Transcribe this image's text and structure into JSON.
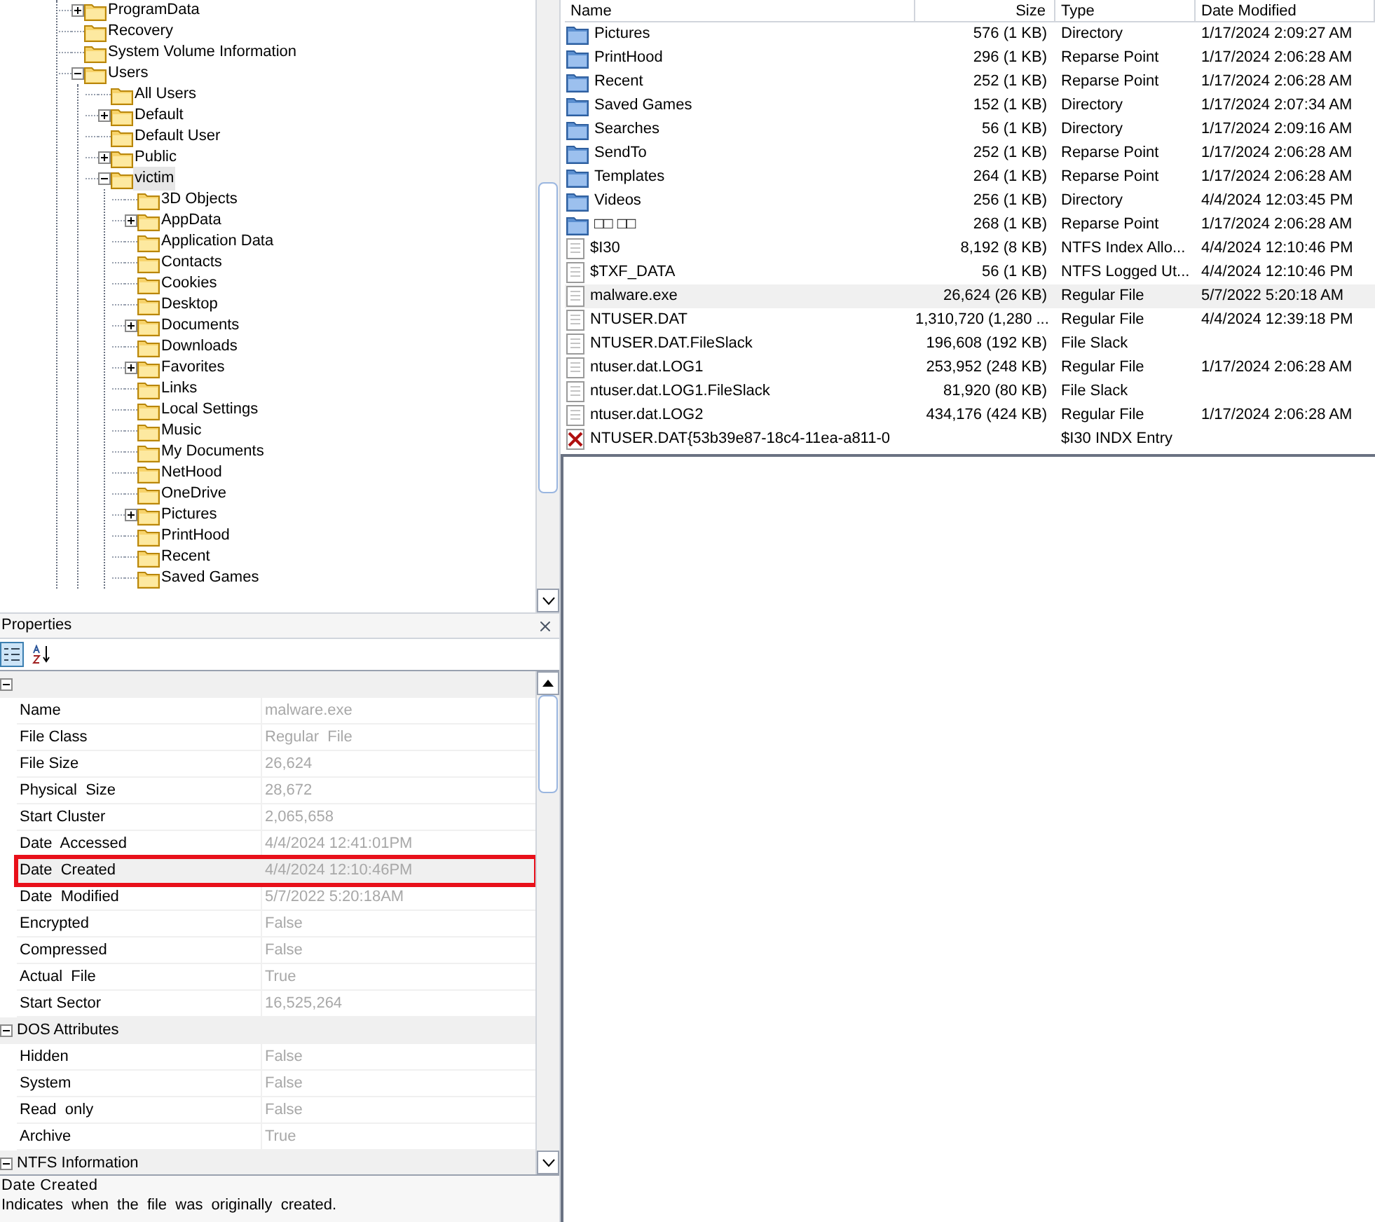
{
  "tree": [
    {
      "label": "ProgramData",
      "expanded": false,
      "selected": false
    },
    {
      "label": "Recovery",
      "selected": false
    },
    {
      "label": "System Volume Information",
      "selected": false
    },
    {
      "label": "Users",
      "expanded": true,
      "selected": false,
      "children": [
        {
          "label": "All Users",
          "selected": false
        },
        {
          "label": "Default",
          "expanded": false,
          "selected": false
        },
        {
          "label": "Default User",
          "selected": false
        },
        {
          "label": "Public",
          "expanded": false,
          "selected": false
        },
        {
          "label": "victim",
          "expanded": true,
          "selected": true,
          "children": [
            {
              "label": "3D Objects",
              "selected": false
            },
            {
              "label": "AppData",
              "expanded": false,
              "selected": false
            },
            {
              "label": "Application Data",
              "selected": false
            },
            {
              "label": "Contacts",
              "selected": false
            },
            {
              "label": "Cookies",
              "selected": false
            },
            {
              "label": "Desktop",
              "selected": false
            },
            {
              "label": "Documents",
              "expanded": false,
              "selected": false
            },
            {
              "label": "Downloads",
              "selected": false
            },
            {
              "label": "Favorites",
              "expanded": false,
              "selected": false
            },
            {
              "label": "Links",
              "selected": false
            },
            {
              "label": "Local Settings",
              "selected": false
            },
            {
              "label": "Music",
              "selected": false
            },
            {
              "label": "My Documents",
              "selected": false
            },
            {
              "label": "NetHood",
              "selected": false
            },
            {
              "label": "OneDrive",
              "selected": false
            },
            {
              "label": "Pictures",
              "expanded": false,
              "selected": false
            },
            {
              "label": "PrintHood",
              "selected": false
            },
            {
              "label": "Recent",
              "selected": false
            },
            {
              "label": "Saved Games",
              "selected": false
            }
          ]
        }
      ]
    }
  ],
  "properties": {
    "title": "Properties",
    "toolbar": [
      {
        "kind": "categorized",
        "selected": true
      },
      {
        "kind": "alphabetical",
        "selected": false
      }
    ],
    "groups": [
      {
        "rows": [
          {
            "label": "Name",
            "value": "malware.exe",
            "selected": false,
            "outlined": false
          },
          {
            "label": "File Class",
            "value": "Regular  File",
            "selected": false,
            "outlined": false
          },
          {
            "label": "File Size",
            "value": "26,624",
            "selected": false,
            "outlined": false
          },
          {
            "label": "Physical  Size",
            "value": "28,672",
            "selected": false,
            "outlined": false
          },
          {
            "label": "Start Cluster",
            "value": "2,065,658",
            "selected": false,
            "outlined": false
          },
          {
            "label": "Date  Accessed",
            "value": "4/4/2024 12:41:01PM",
            "selected": false,
            "outlined": false
          },
          {
            "label": "Date  Created",
            "value": "4/4/2024 12:10:46PM",
            "selected": true,
            "outlined": true
          },
          {
            "label": "Date  Modified",
            "value": "5/7/2022 5:20:18AM",
            "selected": false,
            "outlined": false
          },
          {
            "label": "Encrypted",
            "value": "False",
            "selected": false,
            "outlined": false
          },
          {
            "label": "Compressed",
            "value": "False",
            "selected": false,
            "outlined": false
          },
          {
            "label": "Actual  File",
            "value": "True",
            "selected": false,
            "outlined": false
          },
          {
            "label": "Start Sector",
            "value": "16,525,264",
            "selected": false,
            "outlined": false
          }
        ]
      },
      {
        "name": "DOS Attributes",
        "rows": [
          {
            "label": "Hidden",
            "value": "False",
            "selected": false,
            "outlined": false
          },
          {
            "label": "System",
            "value": "False",
            "selected": false,
            "outlined": false
          },
          {
            "label": "Read  only",
            "value": "False",
            "selected": false,
            "outlined": false
          },
          {
            "label": "Archive",
            "value": "True",
            "selected": false,
            "outlined": false
          }
        ]
      },
      {
        "name": "NTFS Information"
      }
    ],
    "description": {
      "title": "Date Created",
      "text": "Indicates  when  the  file  was  originally  created."
    }
  },
  "file_list": {
    "columns": [
      "Name",
      "Size",
      "Type",
      "Date Modified"
    ],
    "rows": [
      {
        "kind": "folder",
        "name": "Pictures",
        "size": "576 (1 KB)",
        "type": "Directory",
        "modified": "1/17/2024 2:09:27 AM",
        "selected": false
      },
      {
        "kind": "folder",
        "name": "PrintHood",
        "size": "296 (1 KB)",
        "type": "Reparse Point",
        "modified": "1/17/2024 2:06:28 AM",
        "selected": false
      },
      {
        "kind": "folder",
        "name": "Recent",
        "size": "252 (1 KB)",
        "type": "Reparse Point",
        "modified": "1/17/2024 2:06:28 AM",
        "selected": false
      },
      {
        "kind": "folder",
        "name": "Saved Games",
        "size": "152 (1 KB)",
        "type": "Directory",
        "modified": "1/17/2024 2:07:34 AM",
        "selected": false
      },
      {
        "kind": "folder",
        "name": "Searches",
        "size": "56 (1 KB)",
        "type": "Directory",
        "modified": "1/17/2024 2:09:16 AM",
        "selected": false
      },
      {
        "kind": "folder",
        "name": "SendTo",
        "size": "252 (1 KB)",
        "type": "Reparse Point",
        "modified": "1/17/2024 2:06:28 AM",
        "selected": false
      },
      {
        "kind": "folder",
        "name": "Templates",
        "size": "264 (1 KB)",
        "type": "Reparse Point",
        "modified": "1/17/2024 2:06:28 AM",
        "selected": false
      },
      {
        "kind": "folder",
        "name": "Videos",
        "size": "256 (1 KB)",
        "type": "Directory",
        "modified": "4/4/2024 12:03:45 PM",
        "selected": false
      },
      {
        "kind": "folder",
        "name": "□□ □□",
        "size": "268 (1 KB)",
        "type": "Reparse Point",
        "modified": "1/17/2024 2:06:28 AM",
        "selected": false
      },
      {
        "kind": "file",
        "name": "$I30",
        "size": "8,192 (8 KB)",
        "type": "NTFS Index Allo...",
        "modified": "4/4/2024 12:10:46 PM",
        "selected": false
      },
      {
        "kind": "file",
        "name": "$TXF_DATA",
        "size": "56 (1 KB)",
        "type": "NTFS Logged Ut...",
        "modified": "4/4/2024 12:10:46 PM",
        "selected": false
      },
      {
        "kind": "file",
        "name": "malware.exe",
        "size": "26,624 (26 KB)",
        "type": "Regular File",
        "modified": "5/7/2022 5:20:18 AM",
        "selected": true
      },
      {
        "kind": "file",
        "name": "NTUSER.DAT",
        "size": "1,310,720 (1,280 ...",
        "type": "Regular File",
        "modified": "4/4/2024 12:39:18 PM",
        "selected": false
      },
      {
        "kind": "file",
        "name": "NTUSER.DAT.FileSlack",
        "size": "196,608 (192 KB)",
        "type": "File Slack",
        "selected": false
      },
      {
        "kind": "file",
        "name": "ntuser.dat.LOG1",
        "size": "253,952 (248 KB)",
        "type": "Regular File",
        "modified": "1/17/2024 2:06:28 AM",
        "selected": false
      },
      {
        "kind": "file",
        "name": "ntuser.dat.LOG1.FileSlack",
        "size": "81,920 (80 KB)",
        "type": "File Slack",
        "selected": false
      },
      {
        "kind": "file",
        "name": "ntuser.dat.LOG2",
        "size": "434,176 (424 KB)",
        "type": "Regular File",
        "modified": "1/17/2024 2:06:28 AM",
        "selected": false
      },
      {
        "kind": "deleted",
        "name": "NTUSER.DAT{53b39e87-18c4-11ea-a811-0",
        "type": "$I30 INDX Entry",
        "selected": false
      }
    ]
  }
}
